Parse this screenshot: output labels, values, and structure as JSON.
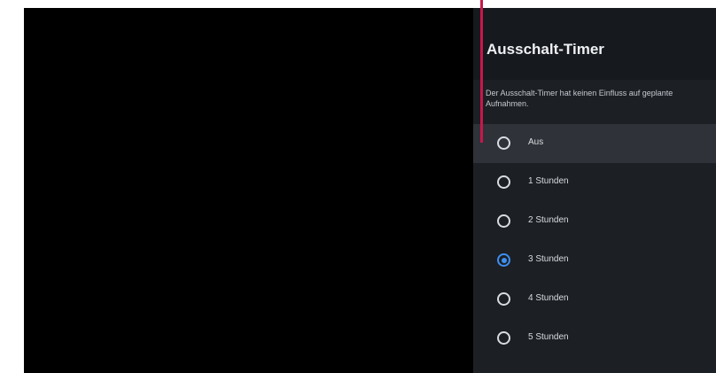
{
  "panel": {
    "title": "Ausschalt-Timer",
    "description": "Der Ausschalt-Timer hat keinen Einfluss auf geplante Aufnahmen."
  },
  "options": [
    {
      "label": "Aus",
      "checked": false,
      "focused": true
    },
    {
      "label": "1 Stunden",
      "checked": false,
      "focused": false
    },
    {
      "label": "2 Stunden",
      "checked": false,
      "focused": false
    },
    {
      "label": "3 Stunden",
      "checked": true,
      "focused": false
    },
    {
      "label": "4 Stunden",
      "checked": false,
      "focused": false
    },
    {
      "label": "5 Stunden",
      "checked": false,
      "focused": false
    }
  ],
  "colors": {
    "panel_background": "#1c1f24",
    "header_background": "#16191d",
    "focus_background": "#2f3339",
    "radio_selected": "#3d8ef0",
    "marker_line": "#c8174b"
  }
}
